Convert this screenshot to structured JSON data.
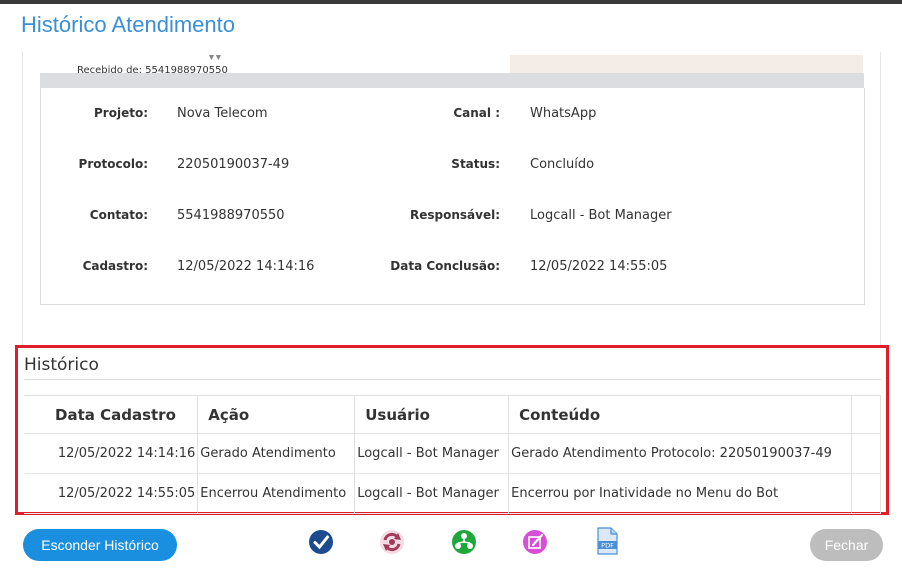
{
  "window": {
    "title": "Histórico Atendimento"
  },
  "preview": {
    "text": "Recebido de: 5541988970550",
    "arrows": "▼▼"
  },
  "info": [
    {
      "label": "Projeto:",
      "value": "Nova Telecom"
    },
    {
      "label": "Canal :",
      "value": "WhatsApp"
    },
    {
      "label": "Protocolo:",
      "value": "22050190037-49"
    },
    {
      "label": "Status:",
      "value": "Concluído"
    },
    {
      "label": "Contato:",
      "value": "5541988970550"
    },
    {
      "label": "Responsável:",
      "value": "Logcall - Bot Manager"
    },
    {
      "label": "Cadastro:",
      "value": "12/05/2022 14:14:16"
    },
    {
      "label": "Data Conclusão:",
      "value": "12/05/2022 14:55:05"
    }
  ],
  "history": {
    "title": "Histórico",
    "columns": [
      "Data Cadastro",
      "Ação",
      "Usuário",
      "Conteúdo"
    ],
    "rows": [
      [
        "12/05/2022 14:14:16",
        "Gerado Atendimento",
        "Logcall - Bot Manager",
        "Gerado Atendimento Protocolo: 22050190037-49"
      ],
      [
        "12/05/2022 14:55:05",
        "Encerrou Atendimento",
        "Logcall - Bot Manager",
        "Encerrou por Inatividade no Menu do Bot"
      ]
    ]
  },
  "footer": {
    "toggle_history_label": "Esconder Histórico",
    "close_label": "Fechar",
    "icons": [
      "check-circle-icon",
      "transfer-cycle-icon",
      "network-users-icon",
      "edit-note-icon",
      "pdf-file-icon"
    ],
    "pdf_label": "PDF"
  },
  "colors": {
    "accent": "#1a8fe0",
    "title": "#3a8fd6",
    "highlight": "#e01e2a",
    "check": "#1c4b8f",
    "transfer": "#a23a5a",
    "network": "#1ea83a",
    "edit": "#d64fd6",
    "pdf": "#4a8fd6"
  }
}
